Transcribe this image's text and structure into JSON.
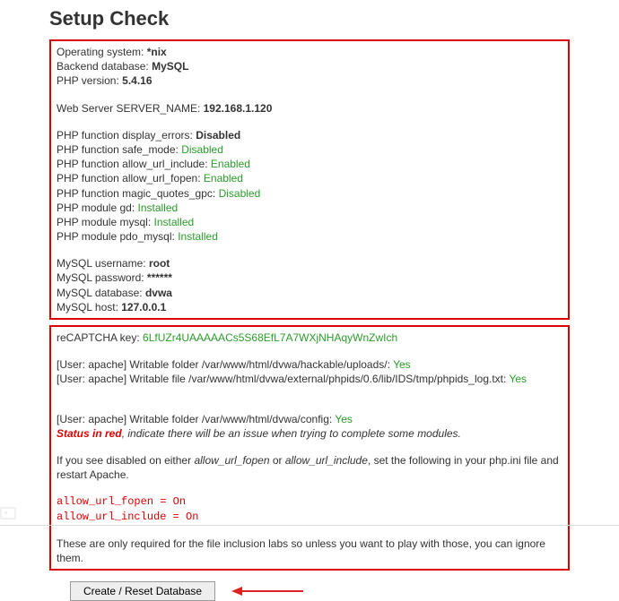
{
  "header": {
    "title": "Setup Check"
  },
  "box1": {
    "os_label": "Operating system: ",
    "os_value": "*nix",
    "db_label": "Backend database: ",
    "db_value": "MySQL",
    "php_label": "PHP version: ",
    "php_value": "5.4.16",
    "server_label": "Web Server SERVER_NAME: ",
    "server_value": "192.168.1.120",
    "display_errors_label": "PHP function display_errors: ",
    "display_errors_value": "Disabled",
    "safe_mode_label": "PHP function safe_mode: ",
    "safe_mode_value": "Disabled",
    "allow_url_include_label": "PHP function allow_url_include: ",
    "allow_url_include_value": "Enabled",
    "allow_url_fopen_label": "PHP function allow_url_fopen: ",
    "allow_url_fopen_value": "Enabled",
    "magic_quotes_label": "PHP function magic_quotes_gpc: ",
    "magic_quotes_value": "Disabled",
    "gd_label": "PHP module gd: ",
    "gd_value": "Installed",
    "mysql_mod_label": "PHP module mysql: ",
    "mysql_mod_value": "Installed",
    "pdo_mysql_label": "PHP module pdo_mysql: ",
    "pdo_mysql_value": "Installed",
    "mysql_user_label": "MySQL username: ",
    "mysql_user_value": "root",
    "mysql_pass_label": "MySQL password: ",
    "mysql_pass_value": "******",
    "mysql_db_label": "MySQL database: ",
    "mysql_db_value": "dvwa",
    "mysql_host_label": "MySQL host: ",
    "mysql_host_value": "127.0.0.1"
  },
  "box2": {
    "recaptcha_label": "reCAPTCHA key: ",
    "recaptcha_value": "6LfUZr4UAAAAACs5S68EfL7A7WXjNHAqyWnZwIch",
    "writable1_label": "[User: apache] Writable folder /var/www/html/dvwa/hackable/uploads/: ",
    "writable1_value": "Yes",
    "writable2_label": "[User: apache] Writable file /var/www/html/dvwa/external/phpids/0.6/lib/IDS/tmp/phpids_log.txt: ",
    "writable2_value": "Yes",
    "writable3_label": "[User: apache] Writable folder /var/www/html/dvwa/config: ",
    "writable3_value": "Yes",
    "status_red": "Status in red",
    "status_rest": ", indicate there will be an issue when trying to complete some modules.",
    "note1_a": "If you see disabled on either ",
    "note1_b": "allow_url_fopen",
    "note1_c": " or ",
    "note1_d": "allow_url_include",
    "note1_e": ", set the following in your php.ini file and restart Apache.",
    "code1": "allow_url_fopen = On",
    "code2": "allow_url_include = On",
    "note2": "These are only required for the file inclusion labs so unless you want to play with those, you can ignore them."
  },
  "button": {
    "label": "Create / Reset Database"
  }
}
